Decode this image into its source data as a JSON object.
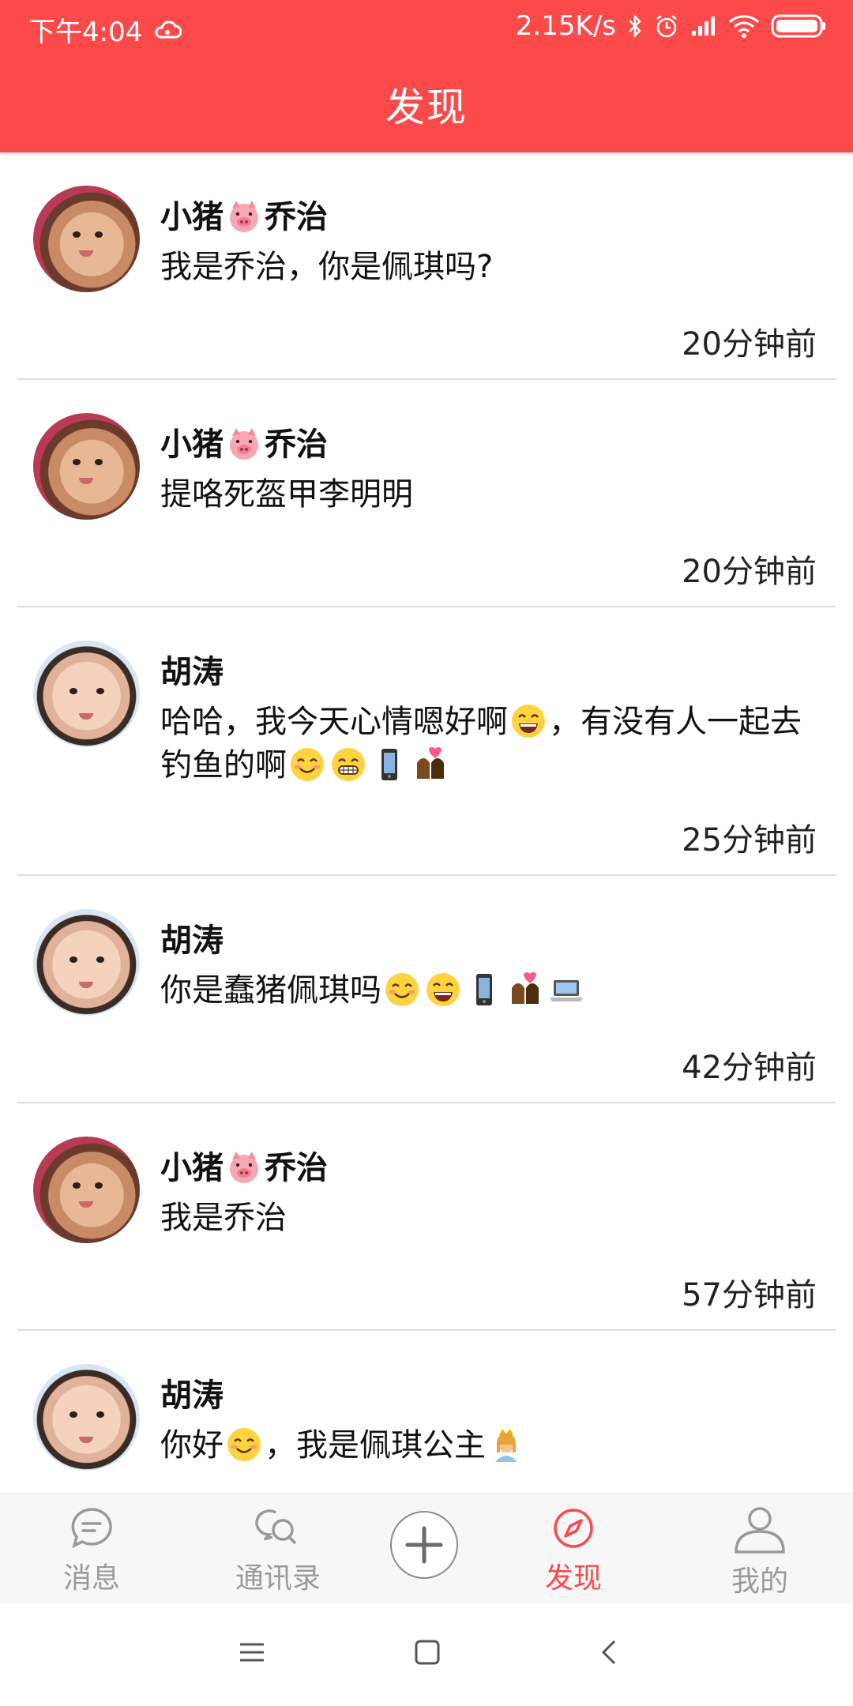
{
  "status_bar": {
    "time": "下午4:04",
    "speed": "2.15K/s"
  },
  "header": {
    "title": "发现"
  },
  "posts": [
    {
      "name": "小猪",
      "name_suffix": "乔治",
      "avatar": "pig",
      "message": "我是乔治，你是佩琪吗?",
      "time": "20分钟前"
    },
    {
      "name": "小猪",
      "name_suffix": "乔治",
      "avatar": "pig",
      "message": "提咯死盔甲李明明",
      "time": "20分钟前"
    },
    {
      "name": "胡涛",
      "avatar": "baby",
      "message_part1": "哈哈，我今天心情嗯好啊",
      "message_part2": "，有没有人一起去钓鱼的啊",
      "time": "25分钟前"
    },
    {
      "name": "胡涛",
      "avatar": "baby",
      "message": "你是蠢猪佩琪吗",
      "time": "42分钟前"
    },
    {
      "name": "小猪",
      "name_suffix": "乔治",
      "avatar": "pig",
      "message": "我是乔治",
      "time": "57分钟前"
    },
    {
      "name": "胡涛",
      "avatar": "baby",
      "message_part1": "你好",
      "message_part2": "，我是佩琪公主"
    }
  ],
  "tabs": [
    {
      "label": "消息",
      "icon": "chat-icon"
    },
    {
      "label": "通讯录",
      "icon": "contacts-icon"
    },
    {
      "label": "",
      "icon": "plus-icon"
    },
    {
      "label": "发现",
      "icon": "compass-icon"
    },
    {
      "label": "我的",
      "icon": "person-icon"
    }
  ],
  "colors": {
    "accent": "#fc4a4b",
    "tab_inactive": "#9a9a9a",
    "divider": "#dcdcdc"
  }
}
